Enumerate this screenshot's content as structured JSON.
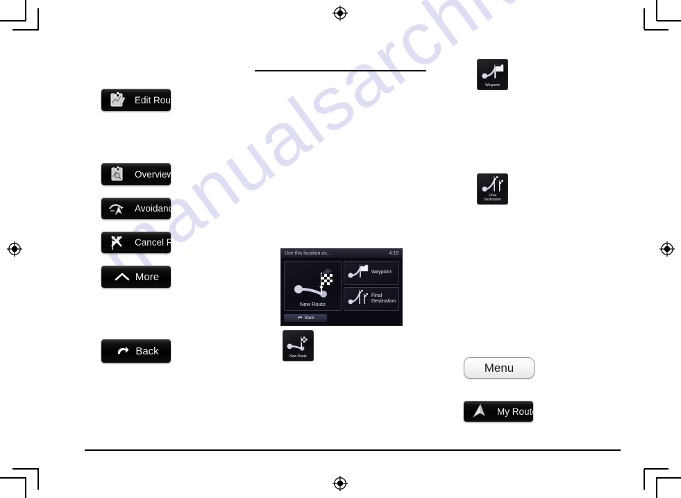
{
  "page": {
    "watermark": "manualsarchive.com"
  },
  "left_column": {
    "buttons": [
      {
        "label": "Edit Route",
        "icon": "edit-route-icon"
      },
      {
        "label": "Overview",
        "icon": "map-overview-icon"
      },
      {
        "label": "Avoidances",
        "icon": "avoidances-icon"
      },
      {
        "label": "Cancel Route",
        "icon": "cancel-route-icon"
      },
      {
        "label": "More",
        "icon": "chevron-up-icon"
      },
      {
        "label": "Back",
        "icon": "back-arrow-icon"
      }
    ]
  },
  "device_screenshot": {
    "title": "Use this location as...",
    "clock": "4:15",
    "main_tile": {
      "label": "New Route",
      "icon": "new-route-icon"
    },
    "side_tiles": [
      {
        "label": "Waypoint",
        "icon": "waypoint-icon"
      },
      {
        "label": "Final\nDestination",
        "label_line1": "Final",
        "label_line2": "Destination",
        "icon": "final-destination-icon"
      }
    ],
    "back_button": {
      "label": "Back",
      "icon": "back-arrow-icon"
    }
  },
  "icon_tiles": {
    "waypoint": {
      "label": "Waypoint",
      "icon": "waypoint-icon"
    },
    "final_destination": {
      "label_line1": "Final",
      "label_line2": "Destination",
      "icon": "final-destination-icon"
    },
    "new_route": {
      "label": "New Route",
      "icon": "new-route-icon"
    }
  },
  "right_column": {
    "menu_button": {
      "label": "Menu"
    },
    "my_route_button": {
      "label": "My Route",
      "icon": "my-route-icon"
    }
  }
}
